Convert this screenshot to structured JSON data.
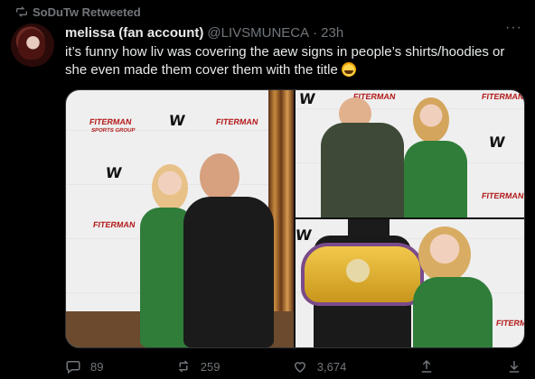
{
  "retweet": {
    "label": "SoDuTw Retweeted"
  },
  "tweet": {
    "display_name": "melissa (fan account)",
    "handle": "@LIVSMUNECA",
    "dot": "·",
    "time": "23h",
    "text": "it’s funny how liv was covering the aew signs in people’s shirts/hoodies or she even made them cover them with the title",
    "emoji": "crying-face"
  },
  "media": {
    "photos": [
      {
        "name": "photo-1"
      },
      {
        "name": "photo-2"
      },
      {
        "name": "photo-3"
      }
    ],
    "backdrop_text": {
      "brand": "FITERMAN",
      "sub": "SPORTS GROUP",
      "wwe": "W"
    }
  },
  "actions": {
    "replies": "89",
    "retweets": "259",
    "likes": "3,674"
  },
  "colors": {
    "bg": "#000000",
    "text": "#e7e9ea",
    "muted": "#71767b",
    "border": "#2f3336",
    "fiterman_red": "#b31b1b"
  }
}
